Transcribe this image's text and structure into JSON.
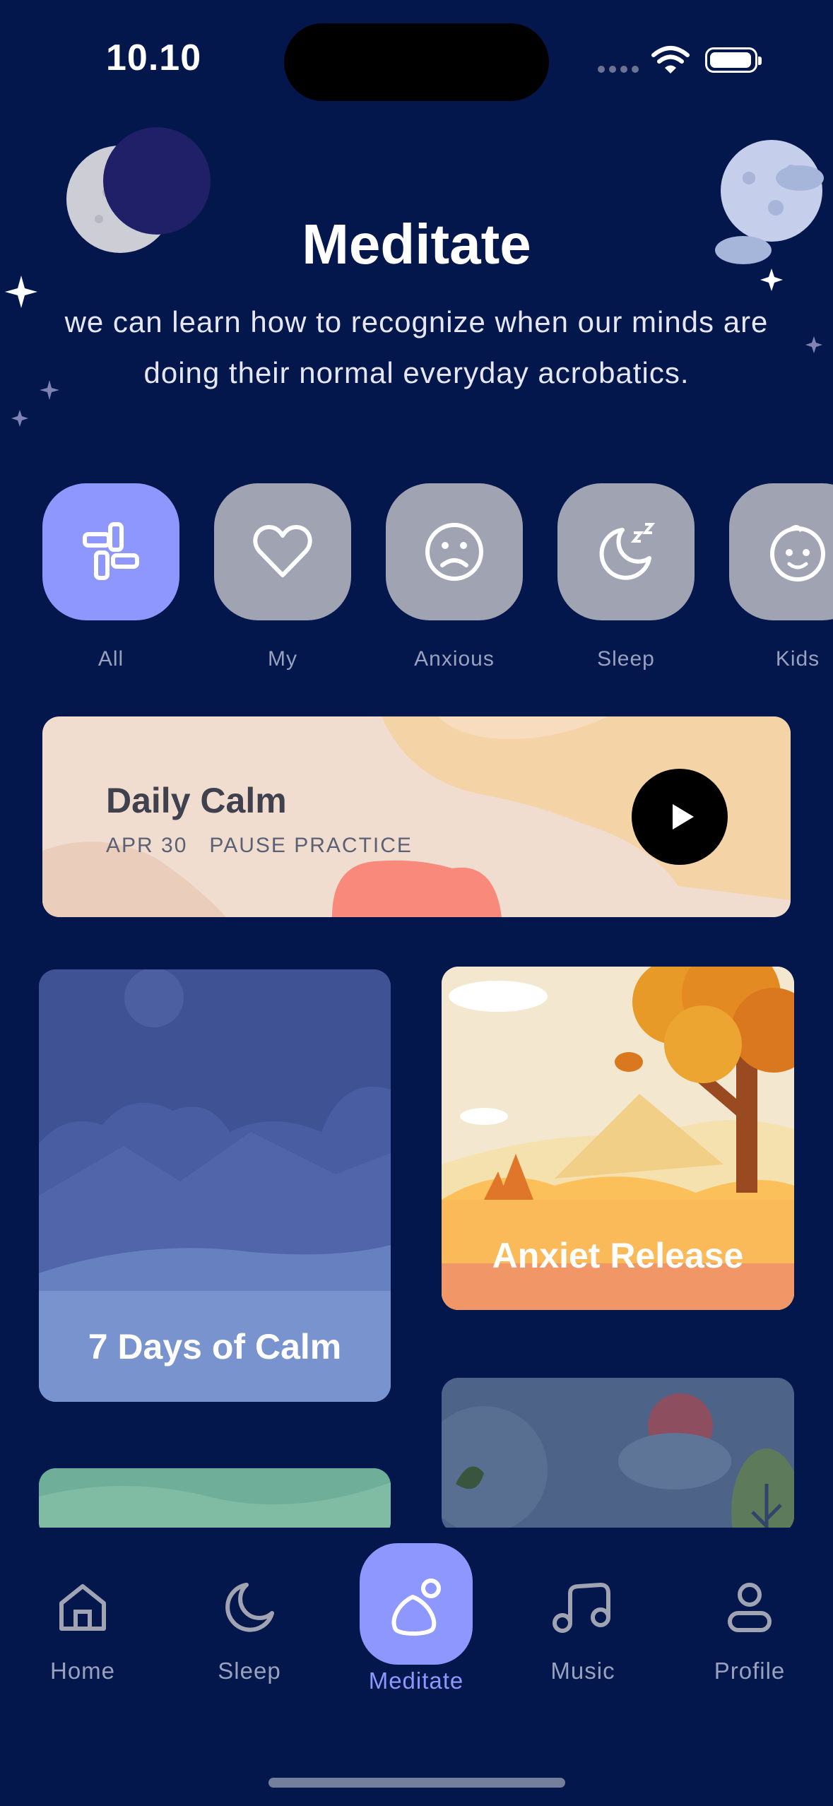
{
  "status": {
    "time": "10.10"
  },
  "header": {
    "title": "Meditate",
    "subtitle": "we can learn how to recognize when our minds are doing their normal everyday acrobatics."
  },
  "categories": [
    {
      "label": "All",
      "icon": "grid-icon",
      "active": true
    },
    {
      "label": "My",
      "icon": "heart-icon",
      "active": false
    },
    {
      "label": "Anxious",
      "icon": "sad-face-icon",
      "active": false
    },
    {
      "label": "Sleep",
      "icon": "moon-zzz-icon",
      "active": false
    },
    {
      "label": "Kids",
      "icon": "baby-face-icon",
      "active": false
    }
  ],
  "daily": {
    "title": "Daily Calm",
    "date": "APR 30",
    "type": "PAUSE PRACTICE"
  },
  "cards": [
    {
      "title": "7 Days of Calm"
    },
    {
      "title": "Anxiet Release"
    },
    {
      "title": ""
    },
    {
      "title": ""
    }
  ],
  "nav": [
    {
      "label": "Home",
      "icon": "home-icon"
    },
    {
      "label": "Sleep",
      "icon": "moon-icon"
    },
    {
      "label": "Meditate",
      "icon": "meditate-icon"
    },
    {
      "label": "Music",
      "icon": "music-icon"
    },
    {
      "label": "Profile",
      "icon": "profile-icon"
    }
  ],
  "colors": {
    "background": "#03174C",
    "accent": "#8E97FD",
    "tile": "#A0A3B1",
    "muted_text": "#98A1BD"
  }
}
